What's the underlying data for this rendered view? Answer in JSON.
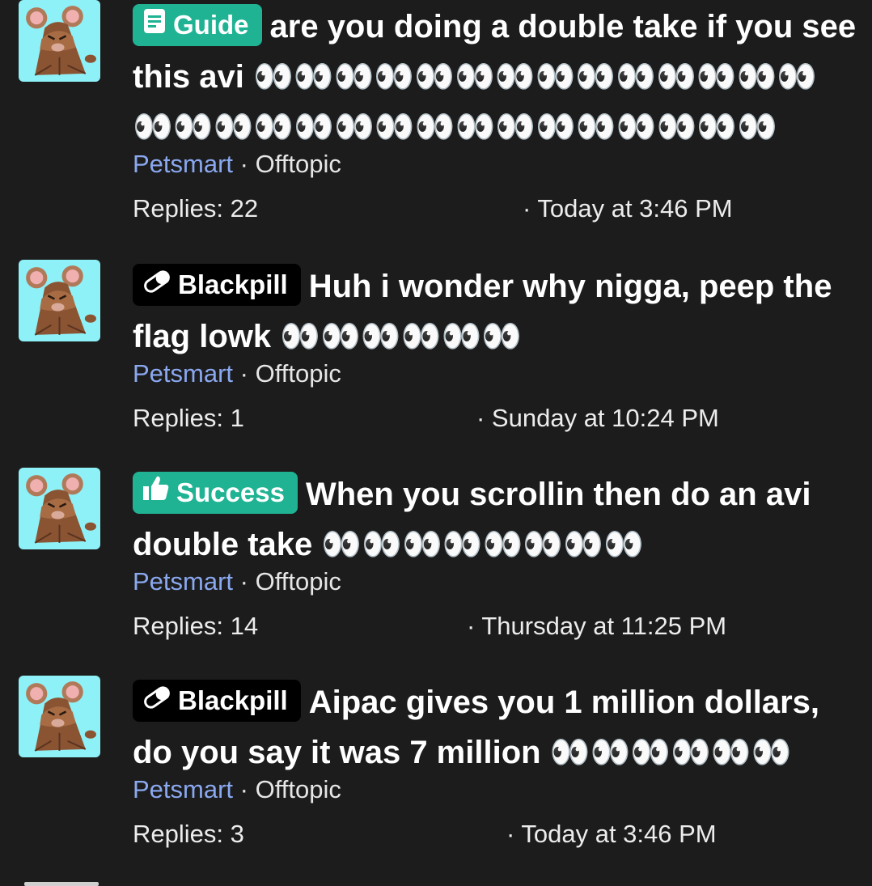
{
  "threads": [
    {
      "prefix": "Guide",
      "prefix_icon": "book-icon",
      "title": "are you doing a double take if you see this avi",
      "emojis": "👀👀👀👀👀👀👀👀👀👀👀👀👀👀👀👀👀👀👀👀👀👀👀👀👀👀👀👀👀👀",
      "author": "Petsmart",
      "separator": "·",
      "forum": "Offtopic",
      "replies": "Replies: 22",
      "date": "· Today at 3:46 PM"
    },
    {
      "prefix": "Blackpill",
      "prefix_icon": "pill-icon",
      "title": "Huh i wonder why nigga, peep the flag lowk",
      "emojis": "👀👀👀👀👀👀",
      "author": "Petsmart",
      "separator": "·",
      "forum": "Offtopic",
      "replies": "Replies: 1",
      "date": "· Sunday at 10:24 PM"
    },
    {
      "prefix": "Success",
      "prefix_icon": "thumbs-up-icon",
      "title": "When you scrollin then do an avi double take",
      "emojis": "👀👀👀👀👀👀👀👀",
      "author": "Petsmart",
      "separator": "·",
      "forum": "Offtopic",
      "replies": "Replies: 14",
      "date": "· Thursday at 11:25 PM"
    },
    {
      "prefix": "Blackpill",
      "prefix_icon": "pill-icon",
      "title": "Aipac gives you 1 million dollars, do you say it was 7 million",
      "emojis": "👀👀👀👀👀👀",
      "author": "Petsmart",
      "separator": "·",
      "forum": "Offtopic",
      "replies": "Replies: 3",
      "date": "· Today at 3:46 PM"
    }
  ],
  "colors": {
    "background": "#1c1c1c",
    "avatar_bg": "#8ef1f7",
    "prefix_guide": "#1fb394",
    "prefix_success": "#1fb394",
    "prefix_blackpill": "#000000",
    "author_link": "#8aa8f0"
  }
}
